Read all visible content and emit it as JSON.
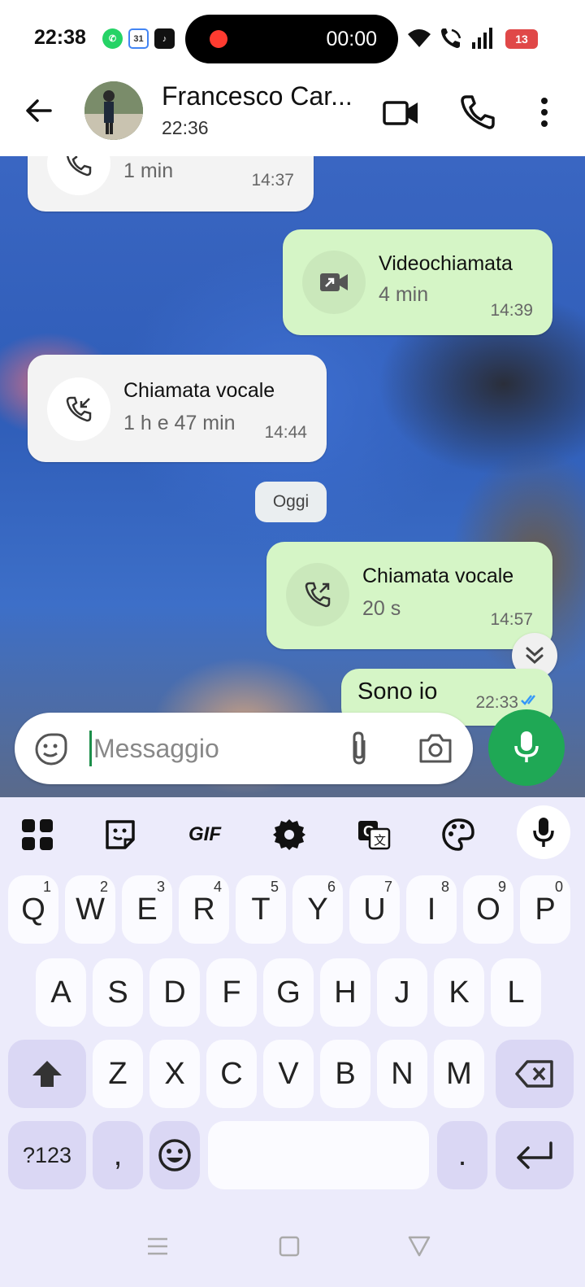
{
  "status_bar": {
    "time": "22:38",
    "calendar_day": "31",
    "recording_timer": "00:00",
    "battery_level": "13"
  },
  "header": {
    "contact_name": "Francesco Car...",
    "subtitle": "22:36"
  },
  "messages": [
    {
      "direction": "in",
      "title": "",
      "duration": "1 min",
      "time": "14:37",
      "icon": "outgoing-call-icon"
    },
    {
      "direction": "out",
      "title": "Videochiamata",
      "duration": "4 min",
      "time": "14:39",
      "icon": "video-call-outgoing-icon"
    },
    {
      "direction": "in",
      "title": "Chiamata vocale",
      "duration": "1 h e 47 min",
      "time": "14:44",
      "icon": "incoming-call-icon"
    },
    {
      "direction": "out",
      "title": "Chiamata vocale",
      "duration": "20 s",
      "time": "14:57",
      "icon": "outgoing-call-icon"
    },
    {
      "direction": "out",
      "text": "Sono io",
      "time": "22:33"
    }
  ],
  "day_separator": "Oggi",
  "composer": {
    "placeholder": "Messaggio"
  },
  "keyboard": {
    "gif_label": "GIF",
    "row1": [
      {
        "key": "Q",
        "hint": "1"
      },
      {
        "key": "W",
        "hint": "2"
      },
      {
        "key": "E",
        "hint": "3"
      },
      {
        "key": "R",
        "hint": "4"
      },
      {
        "key": "T",
        "hint": "5"
      },
      {
        "key": "Y",
        "hint": "6"
      },
      {
        "key": "U",
        "hint": "7"
      },
      {
        "key": "I",
        "hint": "8"
      },
      {
        "key": "O",
        "hint": "9"
      },
      {
        "key": "P",
        "hint": "0"
      }
    ],
    "row2": [
      "A",
      "S",
      "D",
      "F",
      "G",
      "H",
      "J",
      "K",
      "L"
    ],
    "row3": [
      "Z",
      "X",
      "C",
      "V",
      "B",
      "N",
      "M"
    ],
    "symbols_label": "?123",
    "comma": ",",
    "period": "."
  },
  "colors": {
    "accent_green": "#1fa855",
    "outgoing_bubble": "#d5f5c6",
    "incoming_bubble": "#f3f3f3",
    "keyboard_bg": "#ecebfb"
  }
}
